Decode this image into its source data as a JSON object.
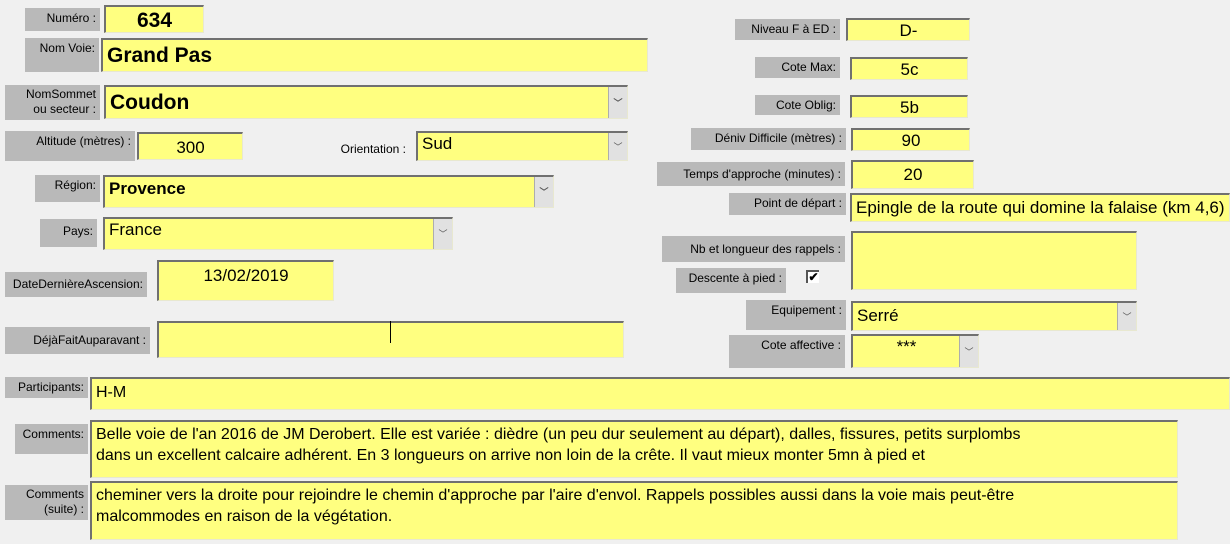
{
  "colors": {
    "field": "#ffff80",
    "label": "#b9b9b9",
    "background": "#f0f0f0"
  },
  "numero": {
    "label": "Numéro :",
    "value": "634"
  },
  "nom_voie": {
    "label": "Nom Voie:",
    "value": "Grand Pas"
  },
  "nom_sommet": {
    "label": "NomSommet\nou secteur :",
    "value": "Coudon"
  },
  "altitude": {
    "label": "Altitude (mètres) :",
    "value": "300"
  },
  "orientation": {
    "label": "Orientation :",
    "value": "Sud"
  },
  "region": {
    "label": "Région:",
    "value": "Provence"
  },
  "pays": {
    "label": "Pays:",
    "value": "France"
  },
  "date_derniere": {
    "label": "DateDernièreAscension:",
    "value": "13/02/2019"
  },
  "deja_fait": {
    "label": "DéjàFaitAuparavant :",
    "value": ""
  },
  "niveau": {
    "label": "Niveau F à ED :",
    "value": "D-"
  },
  "cote_max": {
    "label": "Cote Max:",
    "value": "5c"
  },
  "cote_oblig": {
    "label": "Cote Oblig:",
    "value": "5b"
  },
  "deniv": {
    "label": "Déniv Difficile (mètres) :",
    "value": "90"
  },
  "temps_approche": {
    "label": "Temps d'approche (minutes) :",
    "value": "20"
  },
  "point_depart": {
    "label": "Point de départ :",
    "value": "Epingle de la route qui domine la falaise (km 4,6)"
  },
  "rappels": {
    "label": "Nb et longueur des rappels :",
    "value": ""
  },
  "descente": {
    "label": "Descente à pied :",
    "checked": true,
    "mark": "✔"
  },
  "equipement": {
    "label": "Equipement :",
    "value": "Serré"
  },
  "cote_affective": {
    "label": "Cote affective :",
    "value": "***"
  },
  "participants": {
    "label": "Participants:",
    "value": "H-M"
  },
  "comments": {
    "label": "Comments:",
    "value": "Belle voie de l'an 2016 de JM Derobert. Elle est variée : dièdre (un peu dur seulement au départ), dalles, fissures, petits surplombs\ndans un excellent calcaire adhérent. En 3 longueurs on arrive non loin de la crête. Il vaut mieux monter 5mn à pied et"
  },
  "comments_suite": {
    "label": "Comments\n(suite) :",
    "value": "cheminer vers la droite pour rejoindre le chemin d'approche par l'aire d'envol. Rappels possibles aussi dans la voie mais peut-être\nmalcommodes en raison de la végétation."
  },
  "dropdown_icon": "chevron-down-icon"
}
